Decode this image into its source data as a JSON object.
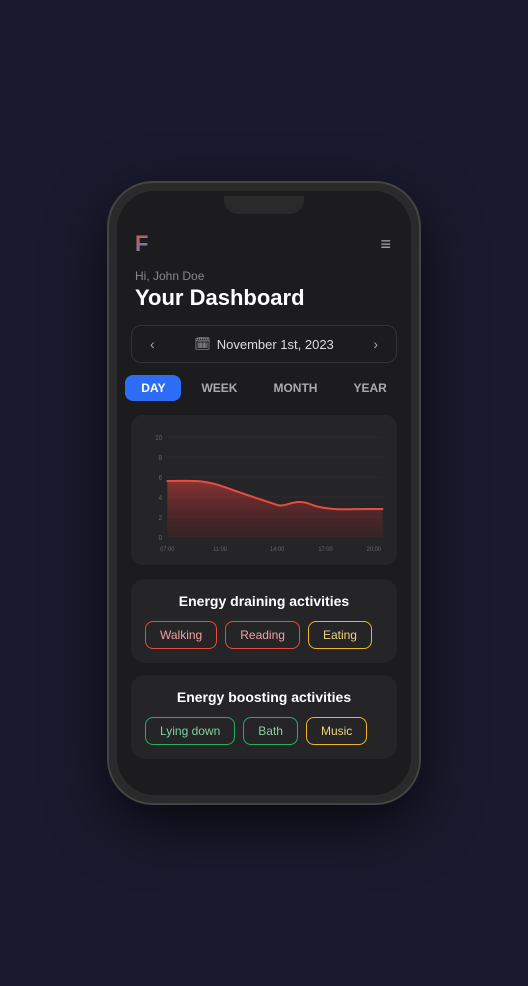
{
  "app": {
    "logo": "F",
    "greeting": "Hi, John Doe",
    "dashboard_title": "Your Dashboard"
  },
  "date_nav": {
    "prev_arrow": "‹",
    "next_arrow": "›",
    "current_date": "November 1st, 2023",
    "calendar_icon": "📅"
  },
  "period_tabs": [
    {
      "label": "DAY",
      "active": true
    },
    {
      "label": "WEEK",
      "active": false
    },
    {
      "label": "MONTH",
      "active": false
    },
    {
      "label": "YEAR",
      "active": false
    }
  ],
  "chart": {
    "y_labels": [
      "0",
      "2",
      "4",
      "6",
      "8",
      "10"
    ],
    "x_labels": [
      "07:00",
      "11:00",
      "14:00",
      "17:00",
      "20:00"
    ],
    "line_color": "#e74c3c",
    "fill_color": "rgba(180, 50, 50, 0.45)"
  },
  "draining": {
    "title": "Energy draining activities",
    "tags": [
      {
        "label": "Walking",
        "style": "red"
      },
      {
        "label": "Reading",
        "style": "red"
      },
      {
        "label": "Eating",
        "style": "yellow"
      }
    ]
  },
  "boosting": {
    "title": "Energy boosting activities",
    "tags": [
      {
        "label": "Lying down",
        "style": "green"
      },
      {
        "label": "Bath",
        "style": "green"
      },
      {
        "label": "Music",
        "style": "yellow"
      }
    ]
  },
  "hamburger_icon": "≡"
}
